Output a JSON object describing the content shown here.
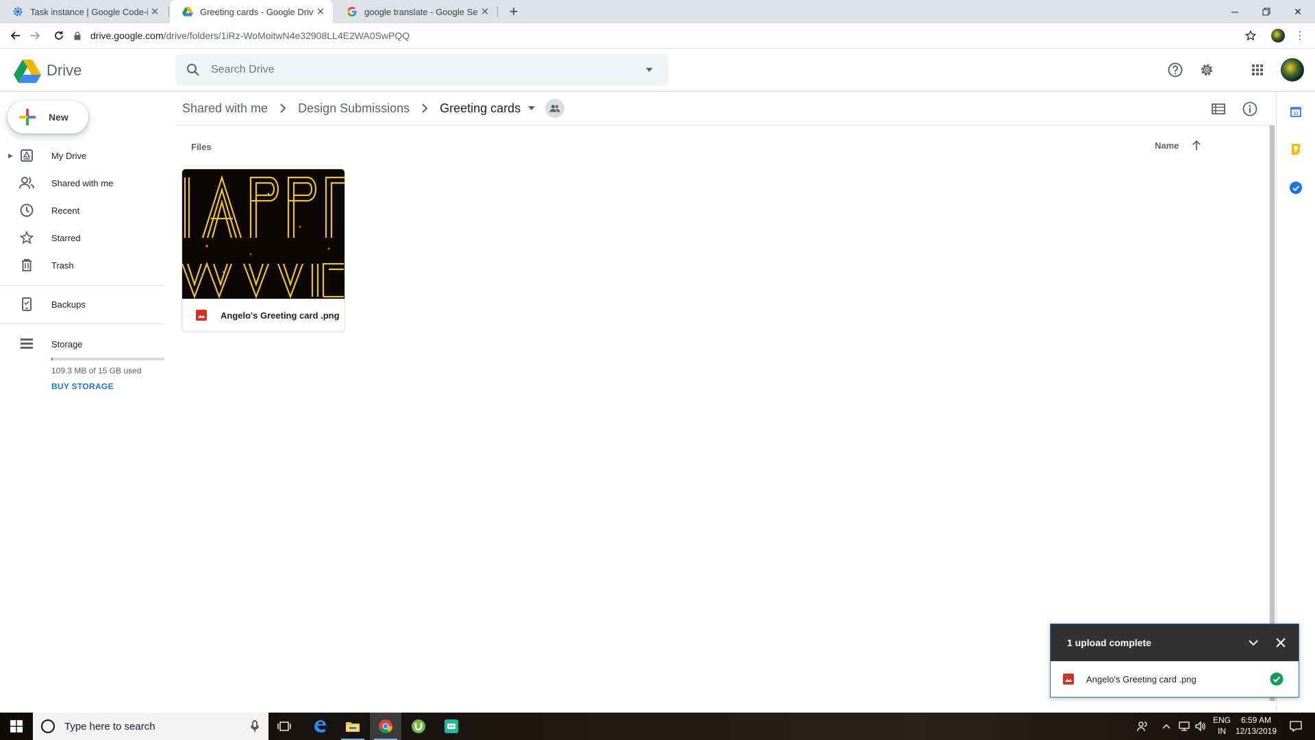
{
  "browser": {
    "tabs": [
      {
        "title": "Task instance | Google Code-in",
        "icon": "gear-icon"
      },
      {
        "title": "Greeting cards - Google Drive",
        "icon": "drive-icon",
        "active": true
      },
      {
        "title": "google translate - Google Search",
        "icon": "google-icon"
      }
    ],
    "new_tab": "+",
    "url_host": "drive.google.com",
    "url_path": "/drive/folders/1iRz-WoMoitwN4e32908LL4E2WA0SwPQQ"
  },
  "drive": {
    "app_name": "Drive",
    "search_placeholder": "Search Drive",
    "new_label": "New",
    "nav": {
      "my_drive": "My Drive",
      "shared_with_me": "Shared with me",
      "recent": "Recent",
      "starred": "Starred",
      "trash": "Trash",
      "backups": "Backups",
      "storage": "Storage"
    },
    "storage_used_fraction": 0.007,
    "storage_text": "109.3 MB of 15 GB used",
    "buy_storage": "BUY STORAGE",
    "breadcrumb": [
      "Shared with me",
      "Design Submissions",
      "Greeting cards"
    ],
    "files_heading": "Files",
    "sort_label": "Name",
    "files": [
      {
        "name": "Angelo's Greeting card .png",
        "type": "image"
      }
    ],
    "upload": {
      "title": "1 upload complete",
      "file_name": "Angelo's Greeting card .png"
    }
  },
  "taskbar": {
    "search_placeholder": "Type here to search",
    "language": "ENG",
    "region": "IN",
    "time": "6:59 AM",
    "date": "12/13/2019"
  },
  "colors": {
    "accent": "#1a73e8",
    "drive_green": "#0f9d58",
    "drive_yellow": "#f4b400",
    "drive_blue": "#4285f4",
    "image_icon_red": "#d93025",
    "upload_header": "#323232"
  }
}
